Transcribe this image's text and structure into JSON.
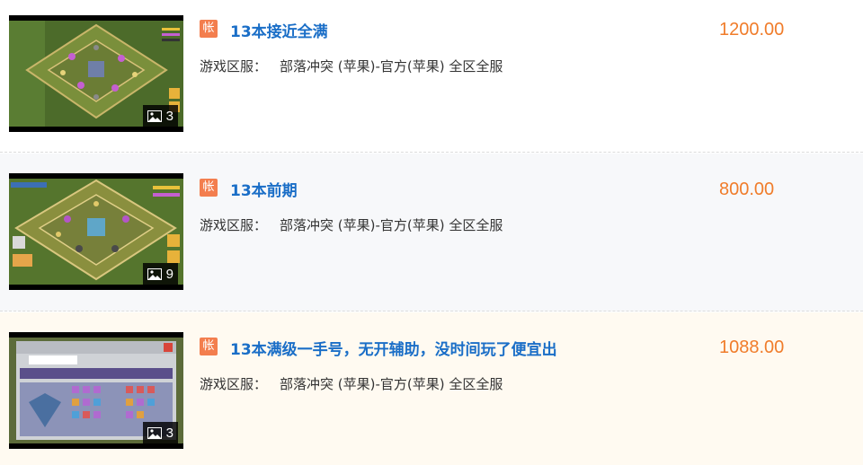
{
  "listings": [
    {
      "tag": "帐",
      "title": "13本接近全满",
      "region_label": "游戏区服：",
      "region_value": "部落冲突 (苹果)-官方(苹果) 全区全服",
      "price": "1200.00",
      "image_count": "3"
    },
    {
      "tag": "帐",
      "title": "13本前期",
      "region_label": "游戏区服：",
      "region_value": "部落冲突 (苹果)-官方(苹果) 全区全服",
      "price": "800.00",
      "image_count": "9"
    },
    {
      "tag": "帐",
      "title": "13本满级一手号，无开辅助，没时间玩了便宜出",
      "region_label": "游戏区服：",
      "region_value": "部落冲突 (苹果)-官方(苹果) 全区全服",
      "price": "1088.00",
      "image_count": "3"
    }
  ],
  "colors": {
    "title": "#1a6ec7",
    "price": "#f07c2a",
    "tag_bg": "#f37e4e"
  },
  "icons": {
    "tag": "account-tag-icon",
    "count": "image-gallery-icon"
  }
}
